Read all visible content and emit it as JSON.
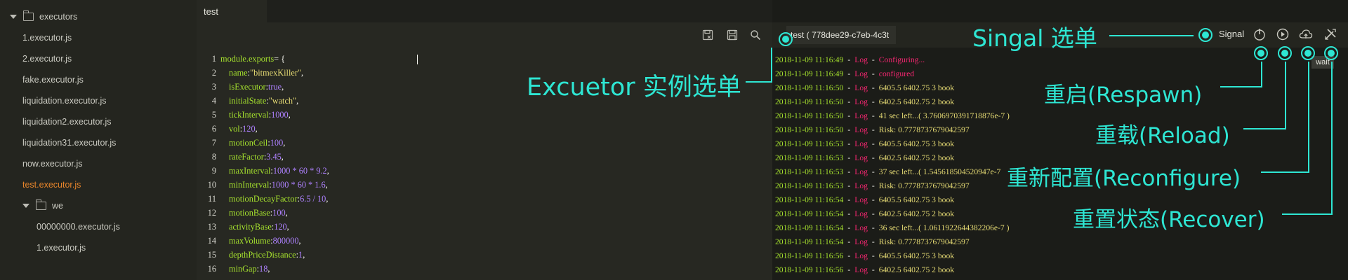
{
  "sidebar": {
    "items": [
      {
        "label": "executors"
      },
      {
        "label": "1.executor.js"
      },
      {
        "label": "2.executor.js"
      },
      {
        "label": "fake.executor.js"
      },
      {
        "label": "liquidation.executor.js"
      },
      {
        "label": "liquidation2.executor.js"
      },
      {
        "label": "liquidation31.executor.js"
      },
      {
        "label": "now.executor.js"
      },
      {
        "label": "test.executor.js"
      },
      {
        "label": "we"
      },
      {
        "label": "00000000.executor.js"
      },
      {
        "label": "1.executor.js"
      }
    ]
  },
  "editor": {
    "tab_label": "test",
    "toolbar": {
      "icons": [
        "save-as-icon",
        "save-icon",
        "search-icon"
      ]
    },
    "lines": [
      {
        "n": "1",
        "key": "module.exports",
        "rest": " = {",
        "val": "",
        "tail": ""
      },
      {
        "n": "2",
        "key": "name",
        "rest": ": ",
        "val": "\"bitmexKiller\"",
        "tail": ","
      },
      {
        "n": "3",
        "key": "isExecutor",
        "rest": ": ",
        "val": "true",
        "tail": ","
      },
      {
        "n": "4",
        "key": "initialState",
        "rest": ": ",
        "val": "\"watch\"",
        "tail": ","
      },
      {
        "n": "5",
        "key": "tickInterval",
        "rest": ": ",
        "val": "1000",
        "tail": ","
      },
      {
        "n": "6",
        "key": "vol",
        "rest": ": ",
        "val": "120",
        "tail": ","
      },
      {
        "n": "7",
        "key": "motionCeil",
        "rest": ": ",
        "val": "100",
        "tail": ","
      },
      {
        "n": "8",
        "key": "rateFactor",
        "rest": ": ",
        "val": "3.45",
        "tail": ","
      },
      {
        "n": "9",
        "key": "maxInterval",
        "rest": ": ",
        "val": "1000 * 60 * 9.2",
        "tail": ","
      },
      {
        "n": "10",
        "key": "minInterval",
        "rest": ": ",
        "val": "1000 * 60 * 1.6",
        "tail": ","
      },
      {
        "n": "11",
        "key": "motionDecayFactor",
        "rest": ": ",
        "val": "6.5 / 10",
        "tail": ","
      },
      {
        "n": "12",
        "key": "motionBase",
        "rest": ": ",
        "val": "100",
        "tail": ","
      },
      {
        "n": "13",
        "key": "activityBase",
        "rest": ": ",
        "val": "120",
        "tail": ","
      },
      {
        "n": "14",
        "key": "maxVolume",
        "rest": ": ",
        "val": "800000",
        "tail": ","
      },
      {
        "n": "15",
        "key": "depthPriceDistance",
        "rest": ": ",
        "val": "1",
        "tail": ","
      },
      {
        "n": "16",
        "key": "minGap",
        "rest": ": ",
        "val": "18",
        "tail": ","
      }
    ]
  },
  "log": {
    "tab_label": "test ( 778dee29-c7eb-4c3t",
    "signal_label": "Signal",
    "icons": [
      "power-icon",
      "reload-icon",
      "cloud-upload-icon",
      "tools-icon"
    ],
    "wait_label": "wait",
    "lines": [
      {
        "date": "2018-11-09 11:16:49",
        "tag": "Log",
        "msg": "Configuring...",
        "msg_color": "red"
      },
      {
        "date": "2018-11-09 11:16:49",
        "tag": "Log",
        "msg": "configured",
        "msg_color": "red"
      },
      {
        "date": "2018-11-09 11:16:50",
        "tag": "Log",
        "msg": "6405.5 6402.75 3 book",
        "msg_color": "mixed"
      },
      {
        "date": "2018-11-09 11:16:50",
        "tag": "Log",
        "msg": "6402.5 6402.75 2 book",
        "msg_color": "mixed"
      },
      {
        "date": "2018-11-09 11:16:50",
        "tag": "Log",
        "msg": "41 sec left...( 3.7606970391718876e-7 )",
        "msg_color": "mixed"
      },
      {
        "date": "2018-11-09 11:16:50",
        "tag": "Log",
        "msg": "Risk: 0.7778737679042597",
        "msg_color": "mixed"
      },
      {
        "date": "2018-11-09 11:16:53",
        "tag": "Log",
        "msg": "6405.5 6402.75 3 book",
        "msg_color": "mixed"
      },
      {
        "date": "2018-11-09 11:16:53",
        "tag": "Log",
        "msg": "6402.5 6402.75 2 book",
        "msg_color": "mixed"
      },
      {
        "date": "2018-11-09 11:16:53",
        "tag": "Log",
        "msg": "37 sec left...( 1.545618504520947e-7",
        "msg_color": "mixed"
      },
      {
        "date": "2018-11-09 11:16:53",
        "tag": "Log",
        "msg": "Risk: 0.7778737679042597",
        "msg_color": "mixed"
      },
      {
        "date": "2018-11-09 11:16:54",
        "tag": "Log",
        "msg": "6405.5 6402.75 3 book",
        "msg_color": "mixed"
      },
      {
        "date": "2018-11-09 11:16:54",
        "tag": "Log",
        "msg": "6402.5 6402.75 2 book",
        "msg_color": "mixed"
      },
      {
        "date": "2018-11-09 11:16:54",
        "tag": "Log",
        "msg": "36 sec left...( 1.0611922644382206e-7 )",
        "msg_color": "mixed"
      },
      {
        "date": "2018-11-09 11:16:54",
        "tag": "Log",
        "msg": "Risk: 0.7778737679042597",
        "msg_color": "mixed"
      },
      {
        "date": "2018-11-09 11:16:56",
        "tag": "Log",
        "msg": "6405.5 6402.75 3 book",
        "msg_color": "mixed"
      },
      {
        "date": "2018-11-09 11:16:56",
        "tag": "Log",
        "msg": "6402.5 6402.75 2 book",
        "msg_color": "mixed"
      }
    ]
  },
  "annotations": {
    "executor_menu": "Excuetor 实例选单",
    "signal_menu": "Singal 选单",
    "respawn": "重启(Respawn)",
    "reload": "重载(Reload)",
    "reconfigure": "重新配置(Reconfigure)",
    "recover": "重置状态(Recover)"
  },
  "colors": {
    "annotation": "#2ee6d3",
    "active_file": "#e6842a",
    "keyword": "#a6e22e",
    "number": "#ae81ff",
    "string": "#e6db74",
    "log_tag": "#f92672"
  }
}
